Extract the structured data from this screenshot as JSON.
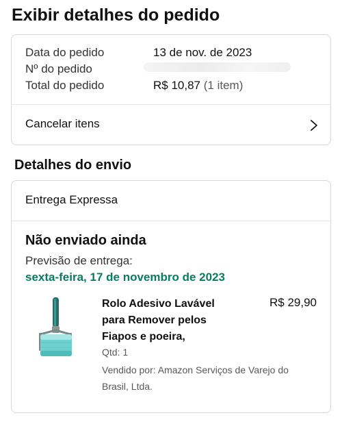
{
  "page": {
    "title": "Exibir detalhes do pedido"
  },
  "summary": {
    "date_label": "Data do pedido",
    "date_value": "13 de nov. de 2023",
    "number_label": "Nº do pedido",
    "total_label": "Total do pedido",
    "total_value": "R$ 10,87",
    "total_items": "(1 item)"
  },
  "cancel": {
    "label": "Cancelar itens",
    "icon": "chevron-right-icon"
  },
  "shipping": {
    "section_title": "Detalhes do envio",
    "method": "Entrega Expressa",
    "status": "Não enviado ainda",
    "eta_label": "Previsão de entrega:",
    "eta_date": "sexta-feira, 17 de novembro de 2023"
  },
  "item": {
    "title": "Rolo Adesivo Lavável para Remover pelos Fiapos e poeira,",
    "price": "R$ 29,90",
    "quantity": "Qtd: 1",
    "seller": "Vendido por: Amazon Serviços de Varejo do Brasil, Ltda."
  },
  "colors": {
    "eta_green": "#067d62",
    "border": "#d5d9d9",
    "muted": "#565959"
  }
}
